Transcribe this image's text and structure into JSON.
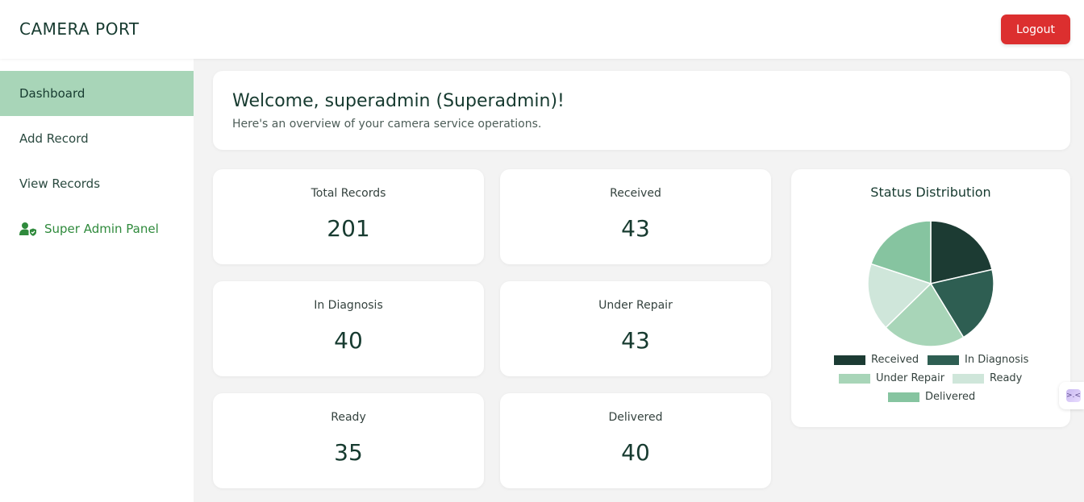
{
  "app": {
    "title": "CAMERA PORT",
    "logout_label": "Logout"
  },
  "sidebar": {
    "items": [
      {
        "label": "Dashboard",
        "active": true
      },
      {
        "label": "Add Record",
        "active": false
      },
      {
        "label": "View Records",
        "active": false
      },
      {
        "label": "Super Admin Panel",
        "active": false,
        "icon": "user-shield-icon"
      }
    ]
  },
  "welcome": {
    "title": "Welcome, superadmin (Superadmin)!",
    "subtitle": "Here's an overview of your camera service operations."
  },
  "stats": [
    {
      "label": "Total Records",
      "value": "201"
    },
    {
      "label": "Received",
      "value": "43"
    },
    {
      "label": "In Diagnosis",
      "value": "40"
    },
    {
      "label": "Under Repair",
      "value": "43"
    },
    {
      "label": "Ready",
      "value": "35"
    },
    {
      "label": "Delivered",
      "value": "40"
    }
  ],
  "chart_data": {
    "type": "pie",
    "title": "Status Distribution",
    "categories": [
      "Received",
      "In Diagnosis",
      "Under Repair",
      "Ready",
      "Delivered"
    ],
    "values": [
      43,
      40,
      43,
      35,
      40
    ],
    "colors": [
      "#1c3b33",
      "#2e5e52",
      "#a8d5b8",
      "#cfe6da",
      "#86c4a0"
    ],
    "legend_position": "bottom"
  }
}
